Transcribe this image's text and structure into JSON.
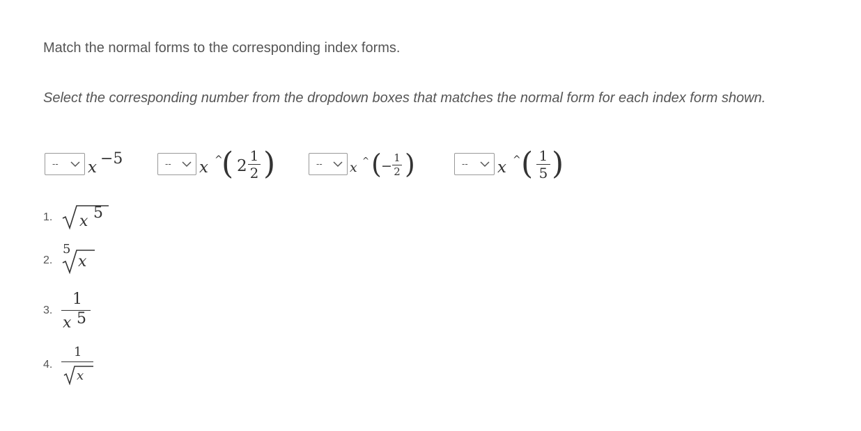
{
  "question": {
    "instructions": "Match the normal forms to the corresponding index forms.",
    "sub_instructions": "Select the corresponding number from the dropdown boxes that matches the normal form for each index form shown."
  },
  "items": [
    {
      "selected": "--",
      "base": "x",
      "exponent": "−5"
    },
    {
      "selected": "--",
      "base": "x",
      "caret": "^",
      "whole": "2",
      "num": "1",
      "den": "2"
    },
    {
      "selected": "--",
      "base": "x",
      "caret": "^",
      "sign": "−",
      "num": "1",
      "den": "2"
    },
    {
      "selected": "--",
      "base": "x",
      "caret": "^",
      "num": "1",
      "den": "5"
    }
  ],
  "options": [
    {
      "number": "1.",
      "radicand": "x",
      "power": "5"
    },
    {
      "number": "2.",
      "index": "5",
      "radicand": "x"
    },
    {
      "number": "3.",
      "num": "1",
      "base": "x",
      "power": "5"
    },
    {
      "number": "4.",
      "num": "1",
      "radicand": "x"
    }
  ],
  "icons": {
    "dropdown": "chevron-down-icon",
    "root": "radical-sign"
  }
}
